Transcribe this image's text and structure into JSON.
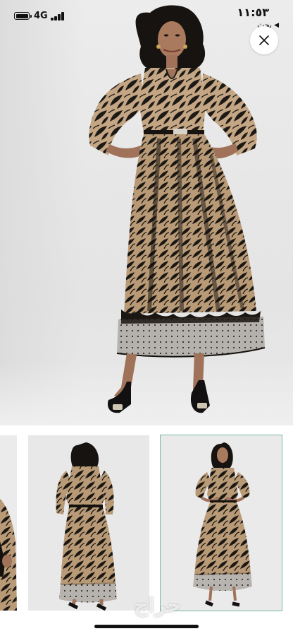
{
  "status_bar": {
    "time": "١١:٥٣",
    "network": "4G",
    "back_label": "بحث"
  },
  "product_images": {
    "main_alt": "model in long-sleeve black lace midi dress with nude lining",
    "thumbnails": [
      {
        "view": "side-detail",
        "selected": false
      },
      {
        "view": "back",
        "selected": false
      },
      {
        "view": "front",
        "selected": true
      }
    ],
    "selected_border_color": "#79b8a8"
  },
  "watermark": {
    "text": "حراج"
  },
  "icons": {
    "close": "close-icon",
    "back": "back-arrow-icon",
    "battery": "battery-icon",
    "signal": "signal-icon"
  },
  "colors": {
    "dress_lace": "#1b1915",
    "dress_lining": "#c9ad8a",
    "background": "#e8e8e8"
  }
}
